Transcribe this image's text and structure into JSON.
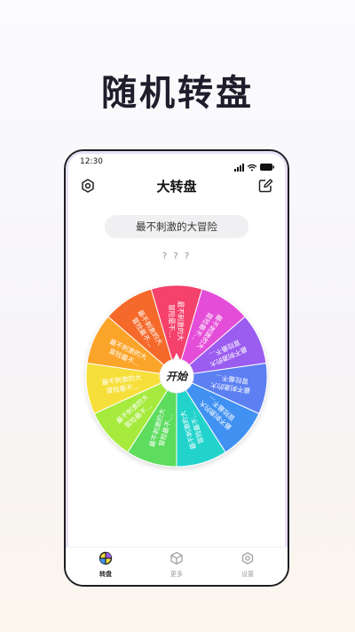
{
  "headline": "随机转盘",
  "status": {
    "time": "12:30"
  },
  "nav": {
    "title": "大转盘"
  },
  "topic": "最不刺激的大冒险",
  "result": "? ? ?",
  "wheel": {
    "center_label": "开始",
    "segments": [
      {
        "line1": "最不刺激的大",
        "line2": "冒险最不…",
        "color": "#f4436c"
      },
      {
        "line1": "最不刺激的大",
        "line2": "冒险最不…",
        "color": "#e44ed8"
      },
      {
        "line1": "最不刺激的大",
        "line2": "冒险最不…",
        "color": "#9b5cf0"
      },
      {
        "line1": "最不刺激的大",
        "line2": "冒险最不…",
        "color": "#5b7ff2"
      },
      {
        "line1": "最不刺激的大",
        "line2": "冒险最不…",
        "color": "#3f91f2"
      },
      {
        "line1": "最不刺激的大",
        "line2": "冒险最不…",
        "color": "#22d3cc"
      },
      {
        "line1": "最不刺激的大",
        "line2": "冒险最不…",
        "color": "#5ddc5d"
      },
      {
        "line1": "最不刺激的大",
        "line2": "冒险最不…",
        "color": "#a6ea3c"
      },
      {
        "line1": "最不刺激的大",
        "line2": "冒险最不…",
        "color": "#f7df3a"
      },
      {
        "line1": "最不刺激的大",
        "line2": "冒险最不…",
        "color": "#fba42a"
      },
      {
        "line1": "最不刺激的大",
        "line2": "冒险最不…",
        "color": "#f56a2c"
      }
    ]
  },
  "tabs": [
    {
      "label": "转盘",
      "icon": "wheel-icon",
      "active": true
    },
    {
      "label": "更多",
      "icon": "cube-icon",
      "active": false
    },
    {
      "label": "设置",
      "icon": "hexagon-settings-icon",
      "active": false
    }
  ]
}
